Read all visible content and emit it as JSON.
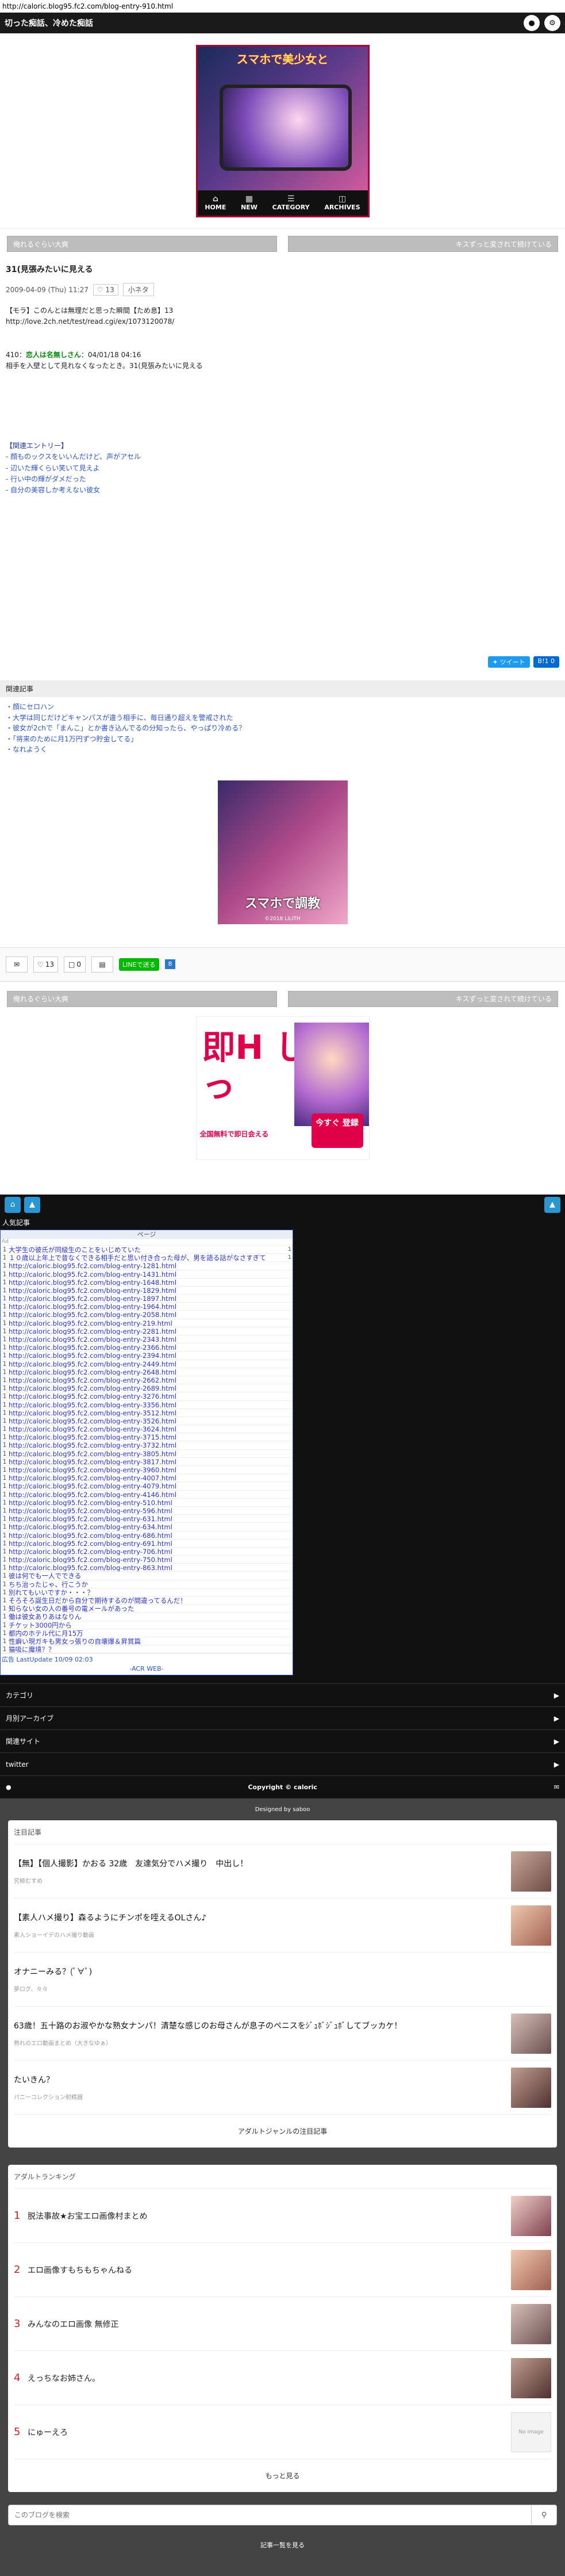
{
  "url": "http://caloric.blog95.fc2.com/blog-entry-910.html",
  "header": {
    "title": "切った痴話、冷めた痴話",
    "icon_a": "person-icon",
    "icon_b": "gear-icon"
  },
  "banner": {
    "title": "スマホで美少女と",
    "nav": [
      {
        "icon": "home-icon",
        "label": "HOME"
      },
      {
        "icon": "new-icon",
        "label": "NEW"
      },
      {
        "icon": "category-icon",
        "label": "CATEGORY"
      },
      {
        "icon": "archives-icon",
        "label": "ARCHIVES"
      }
    ]
  },
  "pager": {
    "prev": "俺れるぐらい大爽",
    "next": "キスずっと変されて続けている"
  },
  "post": {
    "title": "31(見張みたいに見える",
    "date": "2009-04-09 (Thu) 11:27",
    "heart_count": "13",
    "category": "小ネタ",
    "source_title": "【モラ】このんとは無理だと思った瞬間【ため息】13",
    "source_url": "http://love.2ch.net/test/read.cgi/ex/1073120078/",
    "res_num": "410：",
    "res_name": "恋人は名無しさん",
    "res_date": "：04/01/18 04:16",
    "res_body": "相手を入壁として見れなくなったとき。31(見張みたいに見える",
    "related_head": "【関連エントリー】",
    "related": [
      "- 顔ものックスをいいんだけど、声がアセル",
      "- 辺いた輝くらい笑いて見えよ",
      "- 行い中の輝がダメだった",
      "- 自分の美容しか考えない彼女"
    ],
    "tweet": "ツイート",
    "hatena": "B!1 0"
  },
  "kanren": {
    "head": "関連記事",
    "items": [
      "・顔にセロハン",
      "・大学は同じだけどキャンパスが違う相手に、毎日通り超えを警戒された",
      "・彼女が2chで「まんこ」とか書き込んでるの分知ったら、やっぱり冷める？",
      "・「将来のために月1万円ずつ貯金してる」",
      "・なれようく"
    ]
  },
  "mid_ad": {
    "text": "スマホで調教",
    "copy": "©2018 LILITH"
  },
  "actions": {
    "comment_icon": "comment-icon",
    "heart_count": "13",
    "box_count": "0",
    "file_icon": "document-icon",
    "line": "LINEで送る",
    "small": "B"
  },
  "pager2": {
    "prev": "俺れるぐらい大爽",
    "next": "キスずっと変されて続けている"
  },
  "ad2": {
    "big": "即H しよっ",
    "sub": "全国無料で即日会える",
    "btn": "今すぐ 登録"
  },
  "dark": {
    "icon_a": "home-icon",
    "icon_b": "up-icon",
    "icon_c": "up-icon"
  },
  "ninki": {
    "head": "人気記事",
    "ranking_head": "ページ",
    "sub": "Ad",
    "rows": [
      {
        "n": "1",
        "t": "大学生の彼氏が同級生のことをいじめていた",
        "v": "1"
      },
      {
        "n": "1",
        "t": "１０歳以上年上で昔なくできる相手だと思い付き合った母が、男を語る話がなさすぎて",
        "v": "1"
      },
      {
        "n": "1",
        "t": "http://caloric.blog95.fc2.com/blog-entry-1281.html",
        "v": ""
      },
      {
        "n": "1",
        "t": "http://caloric.blog95.fc2.com/blog-entry-1431.html",
        "v": ""
      },
      {
        "n": "1",
        "t": "http://caloric.blog95.fc2.com/blog-entry-1648.html",
        "v": ""
      },
      {
        "n": "1",
        "t": "http://caloric.blog95.fc2.com/blog-entry-1829.html",
        "v": ""
      },
      {
        "n": "1",
        "t": "http://caloric.blog95.fc2.com/blog-entry-1897.html",
        "v": ""
      },
      {
        "n": "1",
        "t": "http://caloric.blog95.fc2.com/blog-entry-1964.html",
        "v": ""
      },
      {
        "n": "1",
        "t": "http://caloric.blog95.fc2.com/blog-entry-2058.html",
        "v": ""
      },
      {
        "n": "1",
        "t": "http://caloric.blog95.fc2.com/blog-entry-219.html",
        "v": ""
      },
      {
        "n": "1",
        "t": "http://caloric.blog95.fc2.com/blog-entry-2281.html",
        "v": ""
      },
      {
        "n": "1",
        "t": "http://caloric.blog95.fc2.com/blog-entry-2343.html",
        "v": ""
      },
      {
        "n": "1",
        "t": "http://caloric.blog95.fc2.com/blog-entry-2366.html",
        "v": ""
      },
      {
        "n": "1",
        "t": "http://caloric.blog95.fc2.com/blog-entry-2394.html",
        "v": ""
      },
      {
        "n": "1",
        "t": "http://caloric.blog95.fc2.com/blog-entry-2449.html",
        "v": ""
      },
      {
        "n": "1",
        "t": "http://caloric.blog95.fc2.com/blog-entry-2648.html",
        "v": ""
      },
      {
        "n": "1",
        "t": "http://caloric.blog95.fc2.com/blog-entry-2662.html",
        "v": ""
      },
      {
        "n": "1",
        "t": "http://caloric.blog95.fc2.com/blog-entry-2689.html",
        "v": ""
      },
      {
        "n": "1",
        "t": "http://caloric.blog95.fc2.com/blog-entry-3276.html",
        "v": ""
      },
      {
        "n": "1",
        "t": "http://caloric.blog95.fc2.com/blog-entry-3356.html",
        "v": ""
      },
      {
        "n": "1",
        "t": "http://caloric.blog95.fc2.com/blog-entry-3512.html",
        "v": ""
      },
      {
        "n": "1",
        "t": "http://caloric.blog95.fc2.com/blog-entry-3526.html",
        "v": ""
      },
      {
        "n": "1",
        "t": "http://caloric.blog95.fc2.com/blog-entry-3624.html",
        "v": ""
      },
      {
        "n": "1",
        "t": "http://caloric.blog95.fc2.com/blog-entry-3715.html",
        "v": ""
      },
      {
        "n": "1",
        "t": "http://caloric.blog95.fc2.com/blog-entry-3732.html",
        "v": ""
      },
      {
        "n": "1",
        "t": "http://caloric.blog95.fc2.com/blog-entry-3805.html",
        "v": ""
      },
      {
        "n": "1",
        "t": "http://caloric.blog95.fc2.com/blog-entry-3817.html",
        "v": ""
      },
      {
        "n": "1",
        "t": "http://caloric.blog95.fc2.com/blog-entry-3960.html",
        "v": ""
      },
      {
        "n": "1",
        "t": "http://caloric.blog95.fc2.com/blog-entry-4007.html",
        "v": ""
      },
      {
        "n": "1",
        "t": "http://caloric.blog95.fc2.com/blog-entry-4079.html",
        "v": ""
      },
      {
        "n": "1",
        "t": "http://caloric.blog95.fc2.com/blog-entry-4146.html",
        "v": ""
      },
      {
        "n": "1",
        "t": "http://caloric.blog95.fc2.com/blog-entry-510.html",
        "v": ""
      },
      {
        "n": "1",
        "t": "http://caloric.blog95.fc2.com/blog-entry-596.html",
        "v": ""
      },
      {
        "n": "1",
        "t": "http://caloric.blog95.fc2.com/blog-entry-631.html",
        "v": ""
      },
      {
        "n": "1",
        "t": "http://caloric.blog95.fc2.com/blog-entry-634.html",
        "v": ""
      },
      {
        "n": "1",
        "t": "http://caloric.blog95.fc2.com/blog-entry-686.html",
        "v": ""
      },
      {
        "n": "1",
        "t": "http://caloric.blog95.fc2.com/blog-entry-691.html",
        "v": ""
      },
      {
        "n": "1",
        "t": "http://caloric.blog95.fc2.com/blog-entry-706.html",
        "v": ""
      },
      {
        "n": "1",
        "t": "http://caloric.blog95.fc2.com/blog-entry-750.html",
        "v": ""
      },
      {
        "n": "1",
        "t": "http://caloric.blog95.fc2.com/blog-entry-863.html",
        "v": ""
      },
      {
        "n": "1",
        "t": "彼は何でも一人でできる",
        "v": ""
      },
      {
        "n": "1",
        "t": "ちち治ったじゃ、行こうか",
        "v": ""
      },
      {
        "n": "1",
        "t": "別れてもいいですか・・・？",
        "v": ""
      },
      {
        "n": "1",
        "t": "そろそろ誕生日だから自分で期待するのが間違ってるんだ！",
        "v": ""
      },
      {
        "n": "1",
        "t": "知らない女の人の番号の電メールがあった",
        "v": ""
      },
      {
        "n": "1",
        "t": "働は彼女ありあはなりん",
        "v": ""
      },
      {
        "n": "1",
        "t": "チケット3000円から",
        "v": ""
      },
      {
        "n": "1",
        "t": "都内のホテル代に月15万",
        "v": ""
      },
      {
        "n": "1",
        "t": "性癖い現ガキも男女っ張りの自壊爆＆昇質篇",
        "v": ""
      },
      {
        "n": "1",
        "t": "猫吸に魔境？？",
        "v": ""
      }
    ],
    "foot_left": "広告",
    "foot_update": "LastUpdate 10/09 02:03",
    "acr": "-ACR WEB-"
  },
  "menu": [
    {
      "label": "カテゴリ"
    },
    {
      "label": "月別アーカイブ"
    },
    {
      "label": "関連サイト"
    },
    {
      "label": "twitter"
    }
  ],
  "copyright": {
    "text": "Copyright © caloric",
    "icon_a": "lock-icon",
    "icon_b": "mail-icon"
  },
  "designed": "Designed by saboo",
  "hot": {
    "head": "注目記事",
    "items": [
      {
        "title": "【無】【個人撮影】かおる 32歳　友達気分でハメ撮り　中出し！",
        "site": "究極むすめ"
      },
      {
        "title": "【素人ハメ撮り】森るようにチンポを咥えるOLさん♪",
        "site": "素人ショーイデのハメ撮り動画"
      },
      {
        "title": "オナニーみる？(ﾟ∀ﾟ)",
        "site": "夢ログ、々々"
      },
      {
        "title": "63歳！五十路のお淑やかな熟女ナンパ！清楚な感じのお母さんが息子のペニスをｼﾞｭﾎﾞｼﾞｭﾎﾞしてブッカケ！",
        "site": "熟れのエロ動画まとめ（大きなゆぁ）"
      },
      {
        "title": "たいきん？",
        "site": "パニーコレクション射精器"
      }
    ],
    "foot": "アダルトジャンルの注目記事"
  },
  "ranking": {
    "head": "アダルトランキング",
    "items": [
      {
        "n": "1",
        "title": "脱法事故★お宝エロ画像村まとめ"
      },
      {
        "n": "2",
        "title": "エロ画像すもちもちゃんねる"
      },
      {
        "n": "3",
        "title": "みんなのエロ画像 無修正"
      },
      {
        "n": "4",
        "title": "えっちなお姉さん。"
      },
      {
        "n": "5",
        "title": "にゅーえろ"
      }
    ],
    "noimg": "No Image",
    "foot": "もっと見る"
  },
  "search": {
    "placeholder": "このブログを検索",
    "icon": "search-icon"
  },
  "footer": {
    "link": "記事一覧を見る"
  }
}
